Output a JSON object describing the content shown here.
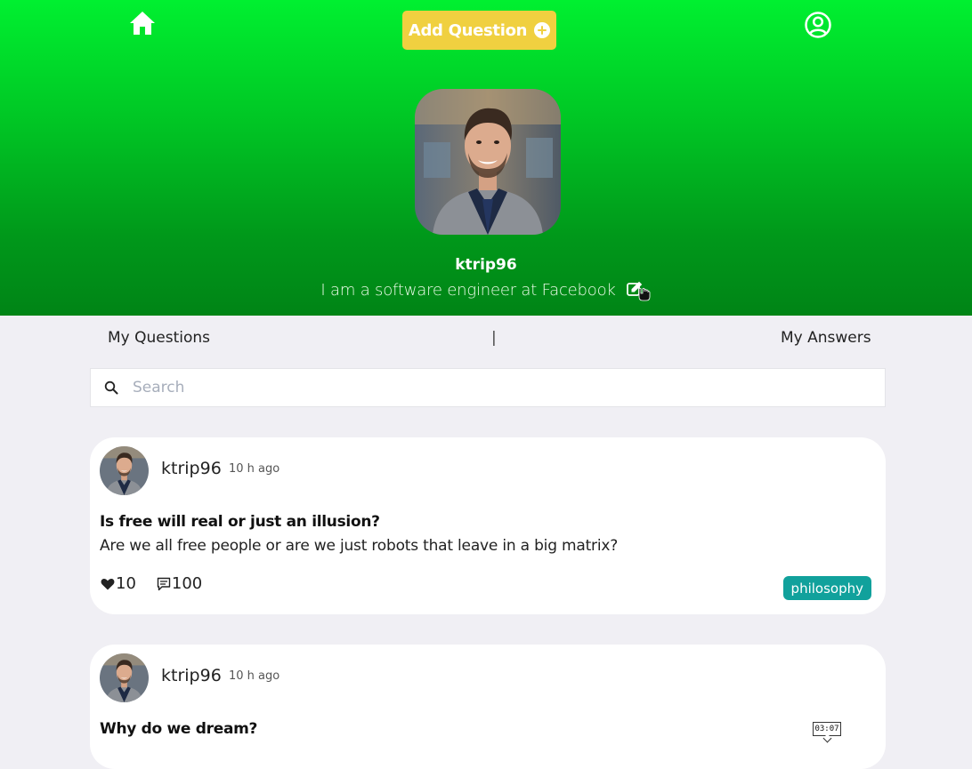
{
  "header": {
    "add_question_label": "Add Question"
  },
  "profile": {
    "username": "ktrip96",
    "bio": "I am a software engineer at Facebook"
  },
  "tabs": {
    "questions_label": "My Questions",
    "separator": "|",
    "answers_label": "My Answers"
  },
  "search": {
    "placeholder": "Search",
    "value": ""
  },
  "questions": [
    {
      "username": "ktrip96",
      "time": "10 h ago",
      "title": "Is free will real or just an illusion?",
      "body": "Are we all free people or are we just robots that leave in a big matrix?",
      "likes": "10",
      "comments": "100",
      "tag": "philosophy"
    },
    {
      "username": "ktrip96",
      "time": "10 h ago",
      "title": "Why do we dream?"
    }
  ],
  "tooltip": {
    "text": "03:07"
  },
  "colors": {
    "hero_top": "#00f030",
    "hero_bottom": "#008416",
    "add_button": "#f0d040",
    "tag": "#11a19c",
    "page_background": "#f0eff4"
  },
  "icons": [
    "home-icon",
    "plus-circle-icon",
    "user-circle-icon",
    "edit-icon",
    "pointer-hand-icon",
    "search-icon",
    "heart-icon",
    "comment-icon"
  ]
}
